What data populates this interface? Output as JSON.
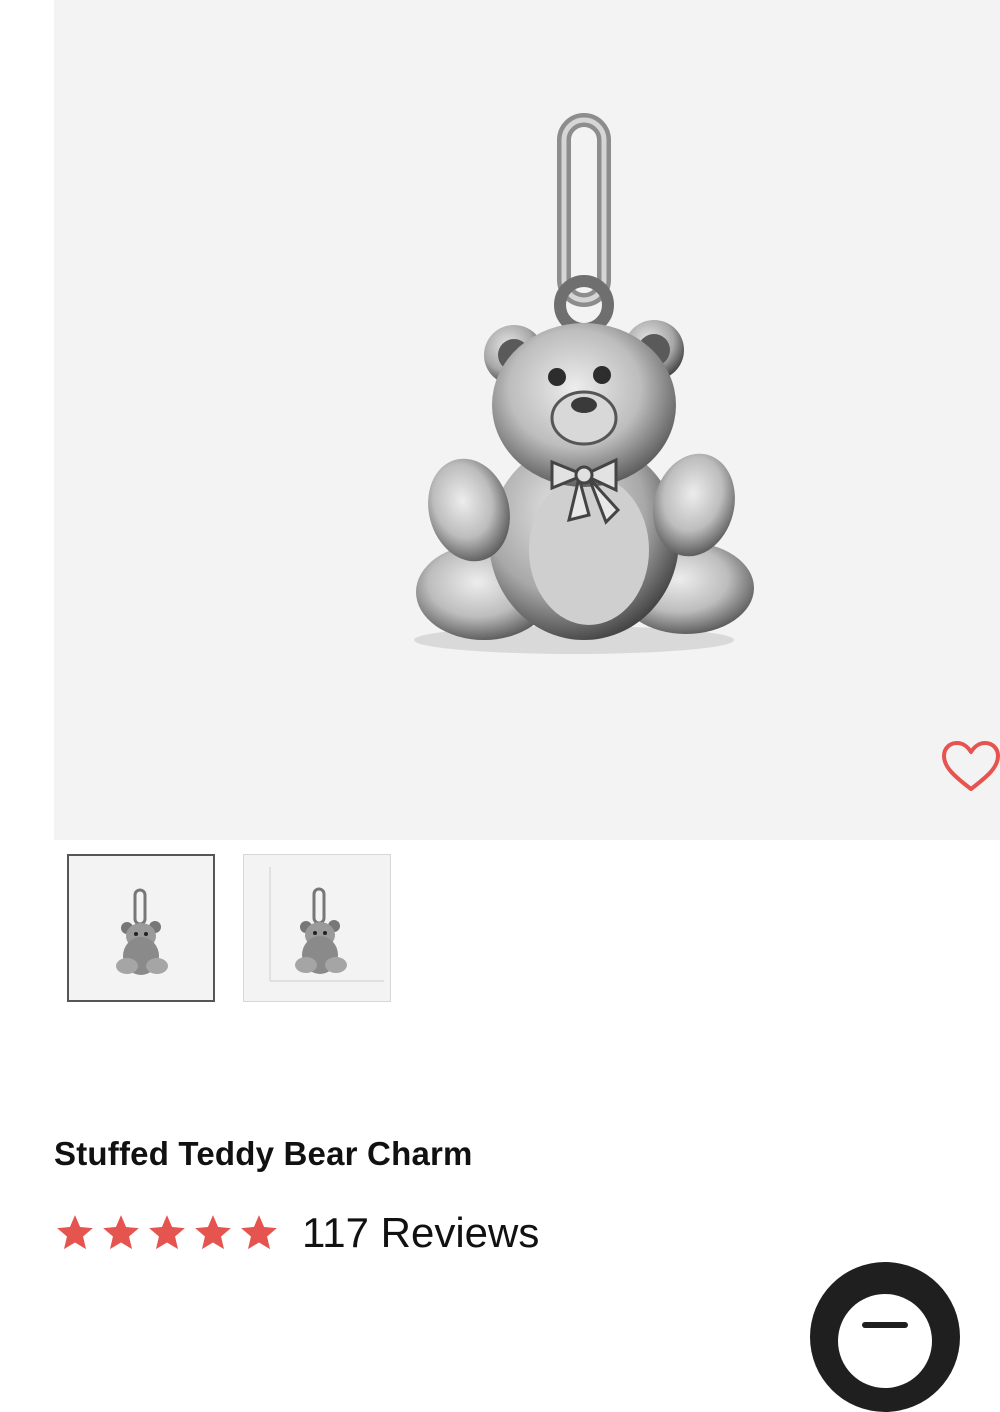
{
  "product": {
    "title": "Stuffed Teddy Bear Charm",
    "rating": 5,
    "rating_max": 5,
    "reviews_label": "117 Reviews"
  },
  "gallery": {
    "main_image": "teddy-bear-charm-photo",
    "thumbnails": [
      "teddy-bear-charm-front",
      "teddy-bear-charm-size-chart"
    ],
    "selected_index": 0
  },
  "icons": {
    "favorite": "heart-outline-icon",
    "star": "star-icon",
    "chat": "chat-icon"
  },
  "colors": {
    "accent": "#e5544f",
    "star": "#e5544f",
    "text": "#111111",
    "image_bg": "#f3f3f3",
    "chat_bg": "#1f1f1f"
  }
}
